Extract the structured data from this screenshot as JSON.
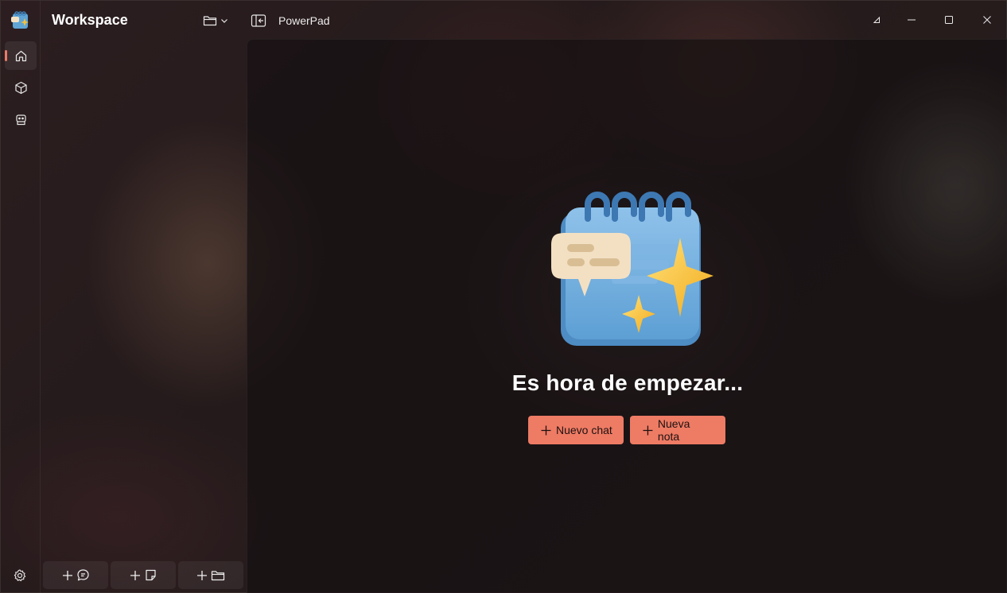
{
  "window": {
    "app_title": "PowerPad",
    "caption_buttons": [
      "compact-overlay-icon",
      "minimize-icon",
      "maximize-icon",
      "close-icon"
    ]
  },
  "rail": {
    "items": [
      {
        "name": "home-icon",
        "active": true
      },
      {
        "name": "cube-icon",
        "active": false
      },
      {
        "name": "robot-icon",
        "active": false
      }
    ],
    "settings_icon": "gear-icon",
    "accent": "#ea7b68"
  },
  "sidebar": {
    "title": "Workspace",
    "folder_dropdown_icon": "folder-icon",
    "bottom_actions": [
      {
        "name": "new-chat-icon"
      },
      {
        "name": "new-note-icon"
      },
      {
        "name": "new-folder-icon"
      }
    ]
  },
  "main": {
    "hero_title": "Es hora de empezar...",
    "buttons": {
      "new_chat": "Nuevo chat",
      "new_note": "Nueva nota"
    },
    "button_color": "#ee7b64"
  }
}
